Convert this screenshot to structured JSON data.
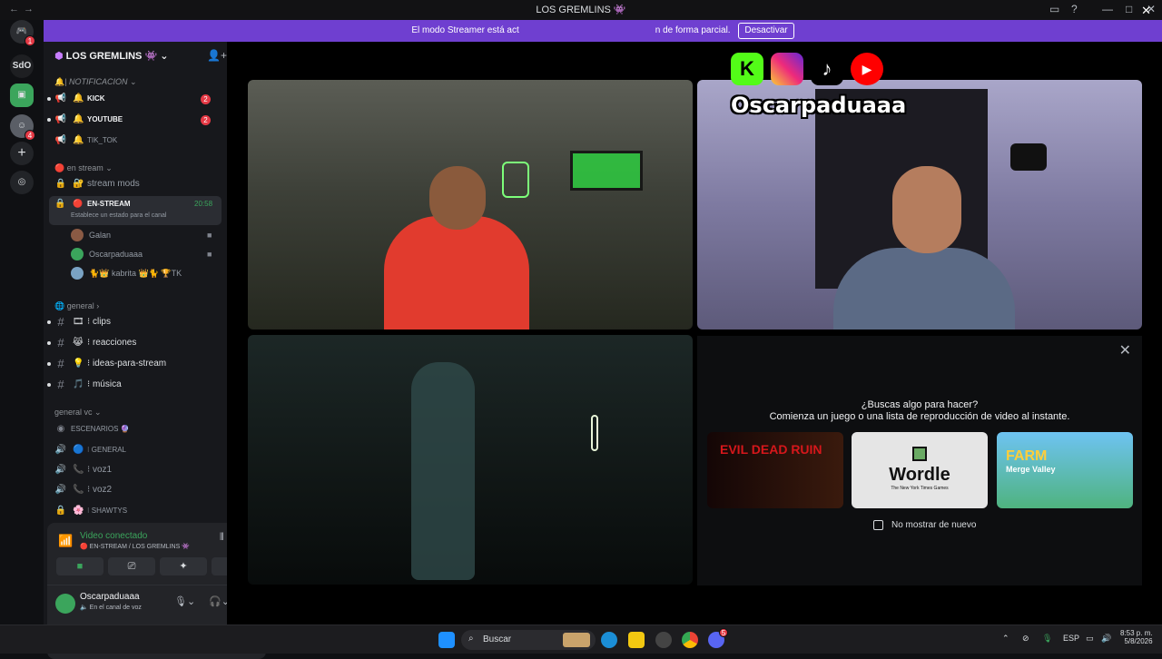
{
  "window": {
    "title": "LOS GREMLINS 👾"
  },
  "banner": {
    "text": "El modo Streamer está activado. La información se oculta de forma parcial.",
    "visible_left": "El modo Streamer está act",
    "visible_right": "n de forma parcial.",
    "button": "Desactivar"
  },
  "server": {
    "name": "LOS GREMLINS 👾",
    "categories": {
      "notificacion": "NOTIFICACION",
      "en_stream": "en stream",
      "general": "general",
      "general_vc": "general vc"
    },
    "notif_channels": [
      {
        "label": "KICK",
        "badge": "2"
      },
      {
        "label": "YOUTUBE",
        "badge": "2"
      },
      {
        "label": "TIK_TOK",
        "badge": ""
      }
    ],
    "stream_mods": "stream mods",
    "en_stream_channel": {
      "label": "EN-STREAM",
      "time": "20:58",
      "status": "Establece un estado para el canal"
    },
    "voice_users": [
      {
        "name": "Galan"
      },
      {
        "name": "Oscarpaduaaa"
      },
      {
        "name": "kabrita",
        "prefix": "🐈👑",
        "suffix": "👑🐈 🏆TK"
      }
    ],
    "text_channels": [
      {
        "label": "clips",
        "emoji": "🎞"
      },
      {
        "label": "reacciones",
        "emoji": "😹"
      },
      {
        "label": "ideas-para-stream",
        "emoji": "💡"
      },
      {
        "label": "música",
        "emoji": "🎵"
      }
    ],
    "vc_channels": [
      {
        "label": "ESCENARIOS",
        "emoji": "🔮"
      },
      {
        "label": "GENERAL",
        "emoji": "🔵"
      },
      {
        "label": "voz1",
        "emoji": "📞"
      },
      {
        "label": "voz2",
        "emoji": "📞"
      },
      {
        "label": "SHAWTYS",
        "emoji": "🌸"
      }
    ]
  },
  "voice_panel": {
    "status": "Video conectado",
    "channel": "EN-STREAM / LOS GREMLINS 👾"
  },
  "user_panel": {
    "name": "Oscarpaduaaa",
    "status": "En el canal de voz"
  },
  "guilds": [
    {
      "label": "SdO"
    }
  ],
  "overlay": {
    "handle": "Oscarpaduaaa"
  },
  "activity": {
    "question": "¿Buscas algo para hacer?",
    "subtitle": "Comienza un juego o una lista de reproducción de video al instante.",
    "games": [
      {
        "name": "EVIL DEAD RUIN"
      },
      {
        "name": "Wordle",
        "sub": "The New York Times Games"
      },
      {
        "name": "FARM",
        "sub": "Merge Valley"
      }
    ],
    "dont_show": "No mostrar de nuevo"
  },
  "taskbar": {
    "search": "Buscar",
    "lang": "ESP",
    "time": "8:53 p. m.",
    "date": "5/8/2026",
    "discord_badge": "5"
  },
  "colors": {
    "accent": "#6f3fd0",
    "danger": "#e53945",
    "online": "#3ba55c",
    "voice_green": "#3ba55c"
  }
}
